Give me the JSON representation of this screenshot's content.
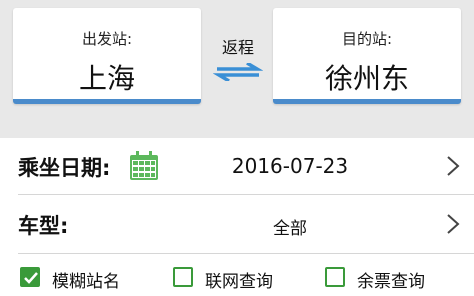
{
  "stations": {
    "from_label": "出发站:",
    "from_value": "上海",
    "to_label": "目的站:",
    "to_value": "徐州东",
    "trip_type": "返程"
  },
  "date_row": {
    "label": "乘坐日期:",
    "value": "2016-07-23",
    "icon": "calendar-icon"
  },
  "type_row": {
    "label": "车型:",
    "value": "全部"
  },
  "options": [
    {
      "label": "模糊站名",
      "checked": true
    },
    {
      "label": "联网查询",
      "checked": false
    },
    {
      "label": "余票查询",
      "checked": false
    }
  ],
  "colors": {
    "accent_blue": "#4a8bcb",
    "check_green": "#3a9a3a",
    "calendar_green": "#5cb85c"
  }
}
